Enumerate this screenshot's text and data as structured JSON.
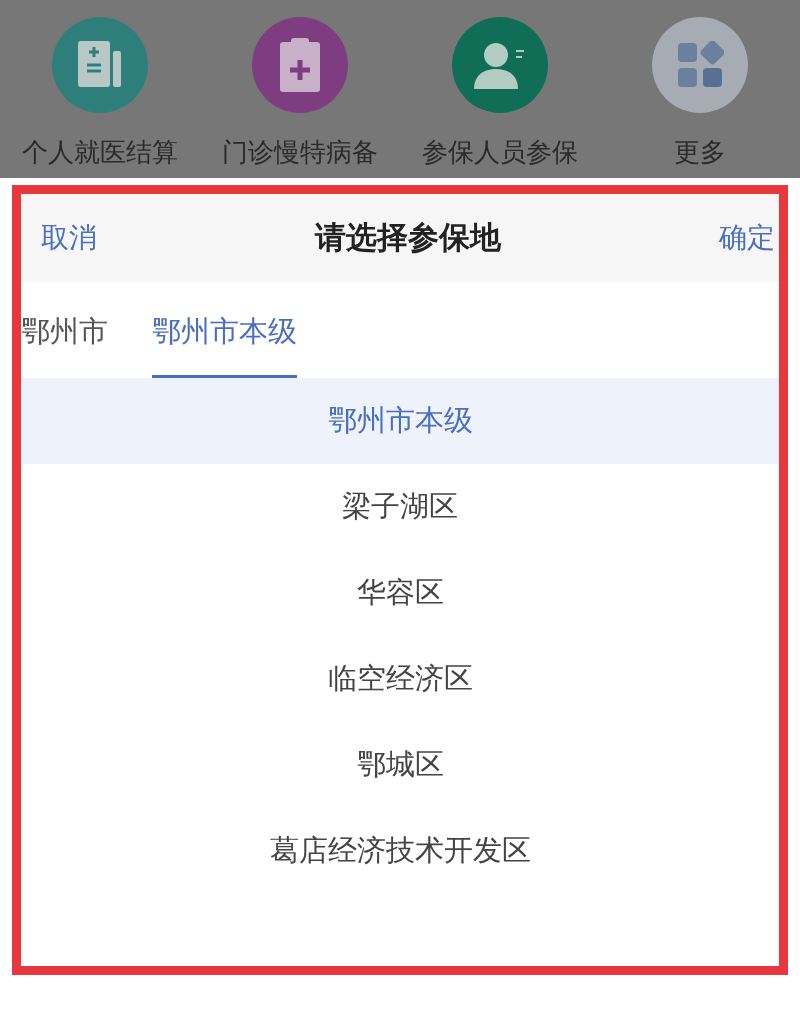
{
  "services": [
    {
      "label": "个人就医结算",
      "color": "#2e7f7c"
    },
    {
      "label": "门诊慢特病备",
      "color": "#7e3d80"
    },
    {
      "label": "参保人员参保",
      "color": "#0f6e55"
    },
    {
      "label": "更多",
      "color": "#a7abb3"
    }
  ],
  "picker": {
    "cancel": "取消",
    "title": "请选择参保地",
    "confirm": "确定",
    "tabs": [
      {
        "label": "鄂州市",
        "selected": false
      },
      {
        "label": "鄂州市本级",
        "selected": true
      }
    ],
    "options": [
      {
        "label": "鄂州市本级",
        "selected": true
      },
      {
        "label": "梁子湖区",
        "selected": false
      },
      {
        "label": "华容区",
        "selected": false
      },
      {
        "label": "临空经济区",
        "selected": false
      },
      {
        "label": "鄂城区",
        "selected": false
      },
      {
        "label": "葛店经济技术开发区",
        "selected": false
      }
    ]
  }
}
